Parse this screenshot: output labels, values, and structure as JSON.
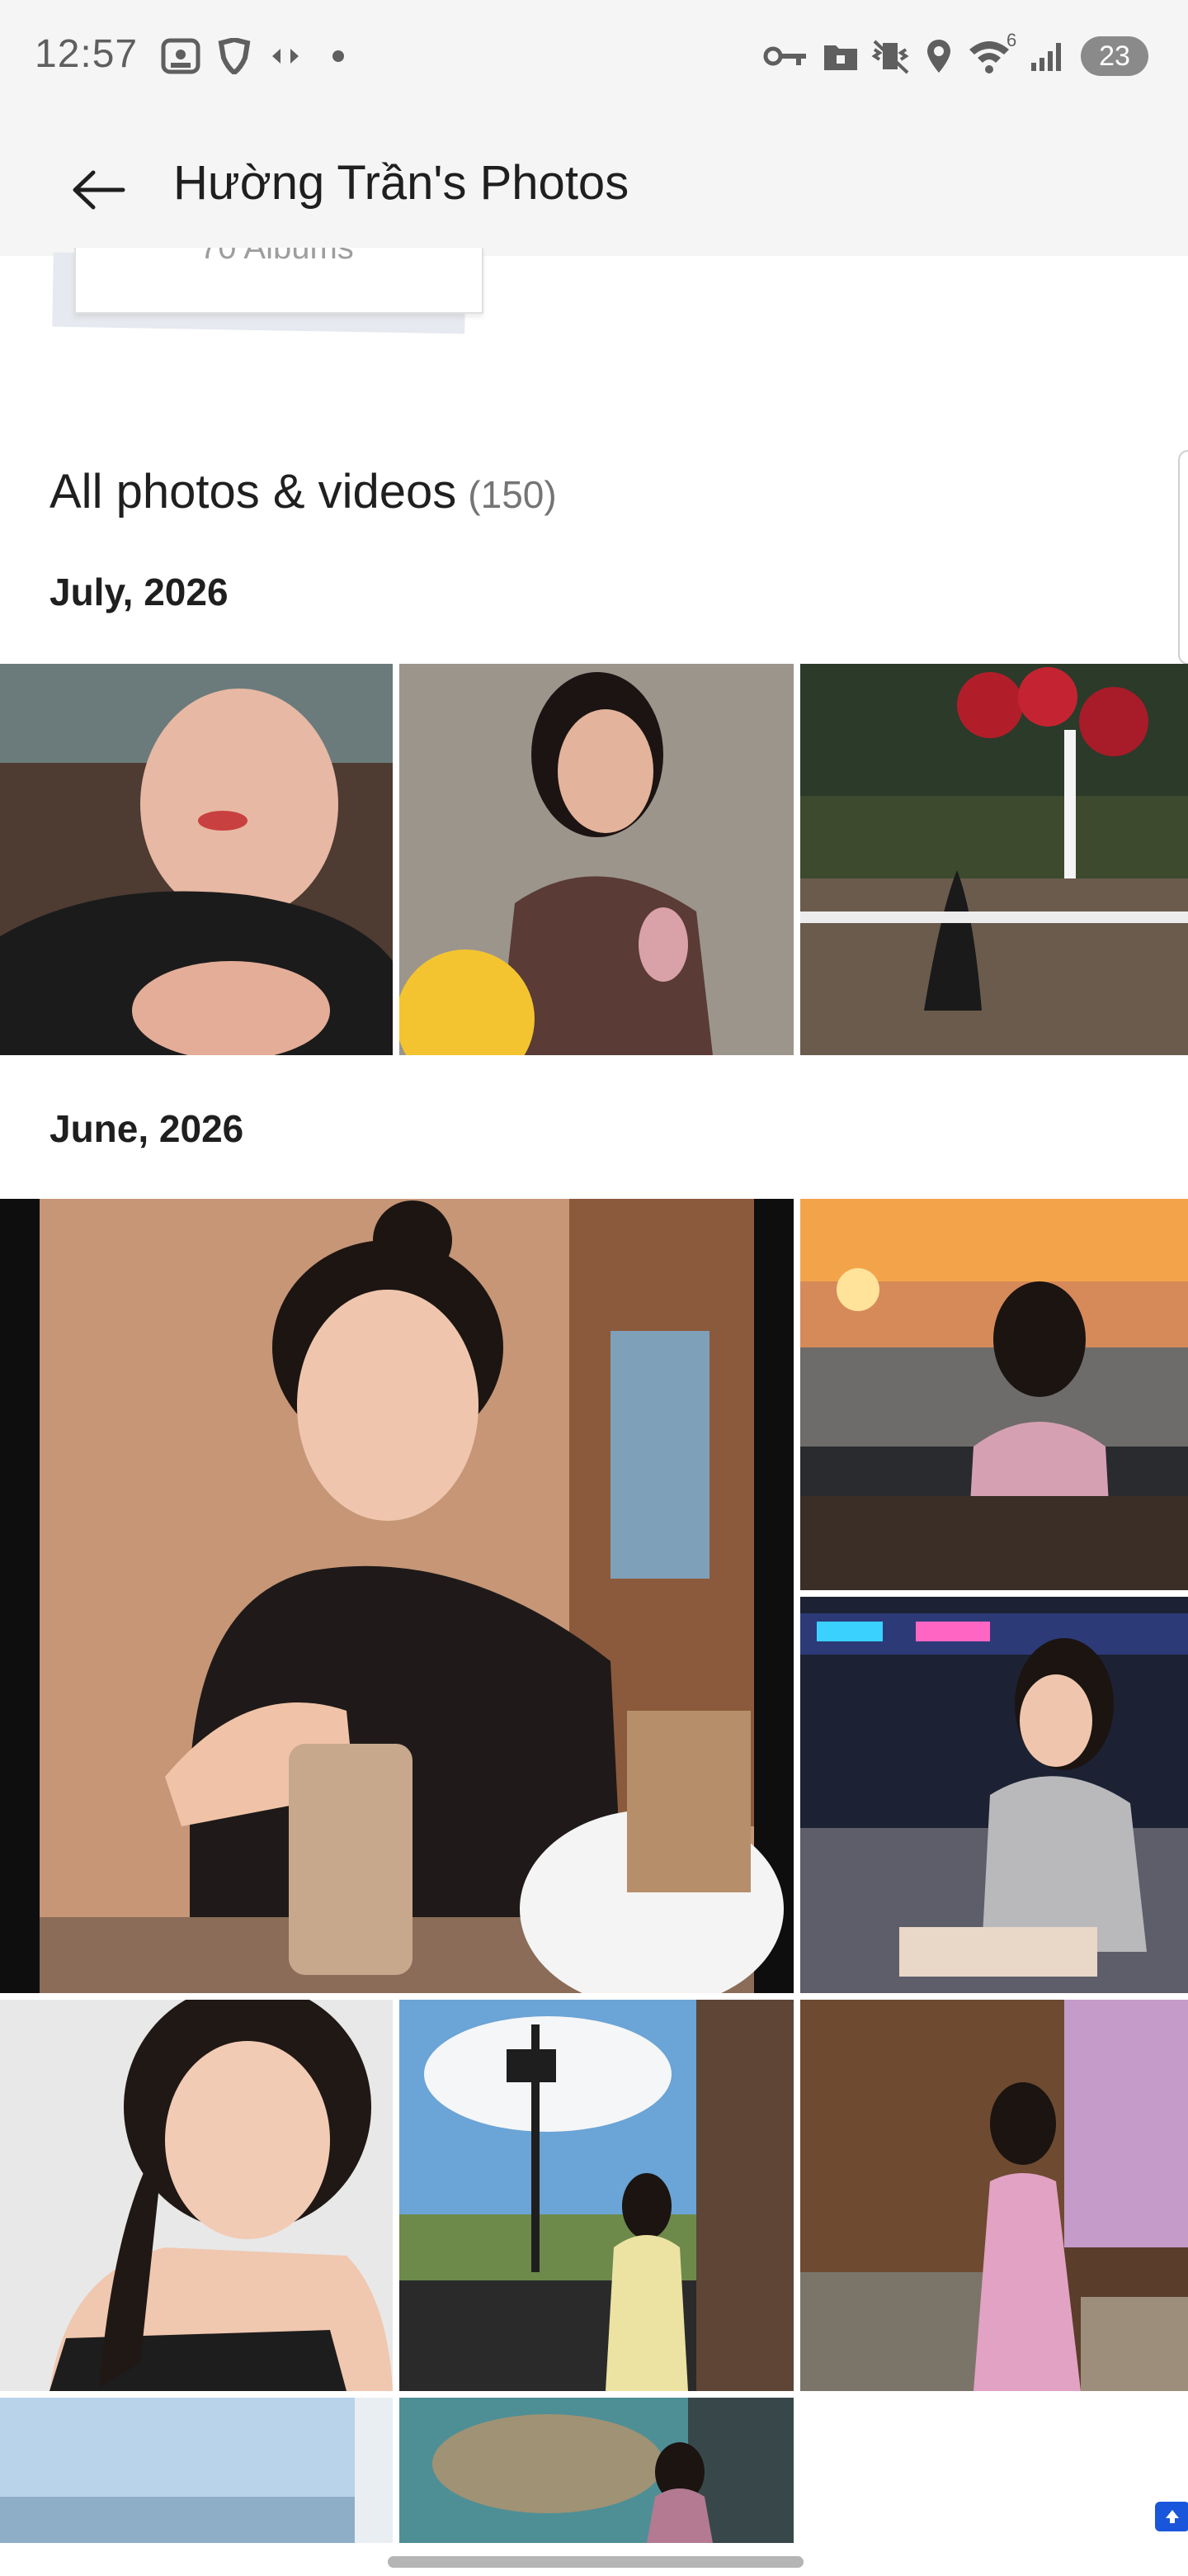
{
  "status_bar": {
    "time": "12:57",
    "left_icons": [
      "screenshot-icon",
      "shield-icon",
      "data-transfer-icon",
      "dot-icon"
    ],
    "right_icons": [
      "vpn-key-icon",
      "folder-lock-icon",
      "vibrate-icon",
      "location-icon",
      "wifi-icon",
      "signal-icon"
    ],
    "wifi_badge": "6",
    "battery": "23"
  },
  "app_bar": {
    "title": "Hường Trần's Photos",
    "back_icon": "arrow-back-icon"
  },
  "album_card": {
    "count_text": "70 Albums"
  },
  "section": {
    "title": "All photos & videos",
    "count": "(150)"
  },
  "months": [
    {
      "label": "July, 2026"
    },
    {
      "label": "June, 2026"
    }
  ],
  "colors": {
    "bar_bg": "#f5f5f5",
    "text_primary": "#1f1f1f",
    "text_secondary": "#757575",
    "accent": "#1a56db"
  }
}
